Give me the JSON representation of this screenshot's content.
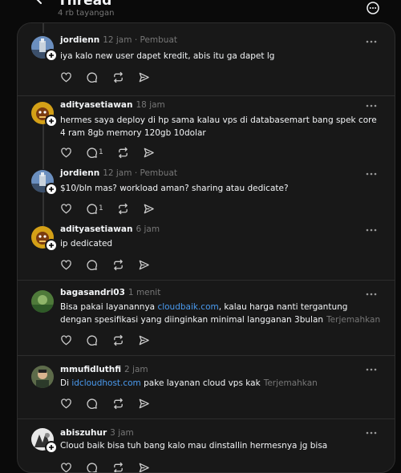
{
  "header": {
    "title": "Thread",
    "views": "4 rb tayangan"
  },
  "colors": {
    "background": "#0a0a0a",
    "panel": "#181818",
    "text": "#f3f5f7",
    "muted": "#777777",
    "link": "#4a9bf0"
  },
  "posts": [
    {
      "username": "jordienn",
      "time": "12 jam",
      "tag": "· Pembuat",
      "text": "iya kalo new user dapet kredit, abis itu ga dapet lg",
      "reply_count": ""
    },
    {
      "username": "adityasetiawan",
      "time": "18 jam",
      "tag": "",
      "text": "hermes saya deploy di hp sama kalau vps di databasemart bang spek core 4 ram 8gb memory 120gb 10dolar",
      "reply_count": "1"
    },
    {
      "username": "jordienn",
      "time": "12 jam",
      "tag": "· Pembuat",
      "text": "$10/bln mas? workload aman? sharing atau dedicate?",
      "reply_count": "1"
    },
    {
      "username": "adityasetiawan",
      "time": "6 jam",
      "tag": "",
      "text": "ip dedicated",
      "reply_count": ""
    },
    {
      "username": "bagasandri03",
      "time": "1 menit",
      "tag": "",
      "text_before": "Bisa pakai layanannya ",
      "link": "cloudbaik.com",
      "text_after": ", kalau harga nanti tergantung dengan spesifikasi yang diinginkan minimal langganan 3bulan",
      "translate": "Terjemahkan",
      "reply_count": ""
    },
    {
      "username": "mmufidluthfi",
      "time": "2 jam",
      "tag": "",
      "text_before": "Di ",
      "link": "idcloudhost.com",
      "text_after": " pake layanan cloud vps kak",
      "translate": "Terjemahkan",
      "reply_count": ""
    },
    {
      "username": "abiszuhur",
      "time": "3 jam",
      "tag": "",
      "text": "Cloud baik bisa tuh bang kalo mau dinstallin hermesnya jg bisa",
      "reply_count": ""
    }
  ],
  "icons": {
    "back": "arrow-left-icon",
    "more": "more-circle-icon",
    "like": "heart-icon",
    "reply": "comment-icon",
    "repost": "repost-icon",
    "share": "share-icon",
    "follow": "plus-icon"
  }
}
